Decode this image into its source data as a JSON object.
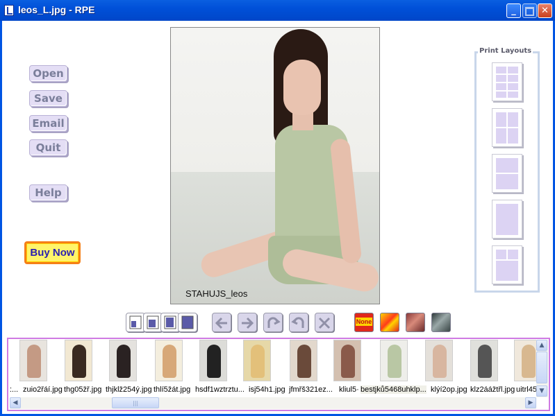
{
  "window": {
    "title": "leos_L.jpg - RPE",
    "minimize_icon": "minimize-icon",
    "maximize_icon": "maximize-icon",
    "close_icon": "close-icon"
  },
  "sidebar": {
    "open_label": "Open",
    "save_label": "Save",
    "email_label": "Email",
    "quit_label": "Quit",
    "help_label": "Help",
    "buy_label": "Buy Now"
  },
  "photo": {
    "caption": "STAHUJS_leos"
  },
  "print_layouts": {
    "title": "Print Layouts",
    "options": [
      {
        "name": "layout-4x2-icon"
      },
      {
        "name": "layout-2x2-icon"
      },
      {
        "name": "layout-2x1-icon"
      },
      {
        "name": "layout-full-icon"
      },
      {
        "name": "layout-mixed-icon"
      }
    ]
  },
  "toolbar": {
    "size_icons": [
      "size-small-icon",
      "size-medium-icon",
      "size-large-icon",
      "size-full-icon"
    ],
    "effect_none_label": "None",
    "accent_red": "#e0281c",
    "accent_purple": "#dcd3f3"
  },
  "thumbnails": {
    "items": [
      {
        "label": ":..."
      },
      {
        "label": "zuio2řáí.jpg"
      },
      {
        "label": "thg05žř.jpg"
      },
      {
        "label": "thjklž254ý.jpg"
      },
      {
        "label": "thlí5žát.jpg"
      },
      {
        "label": "hsdf1wztrztu..."
      },
      {
        "label": "isj54h1.jpg"
      },
      {
        "label": "jfmřš321ez..."
      },
      {
        "label": "kliul5·"
      },
      {
        "label": "bestjků5468uhklp..."
      },
      {
        "label": "klýí2op.jpg"
      },
      {
        "label": "klz2áážtřl.jpg"
      },
      {
        "label": "uitrl45"
      }
    ]
  }
}
